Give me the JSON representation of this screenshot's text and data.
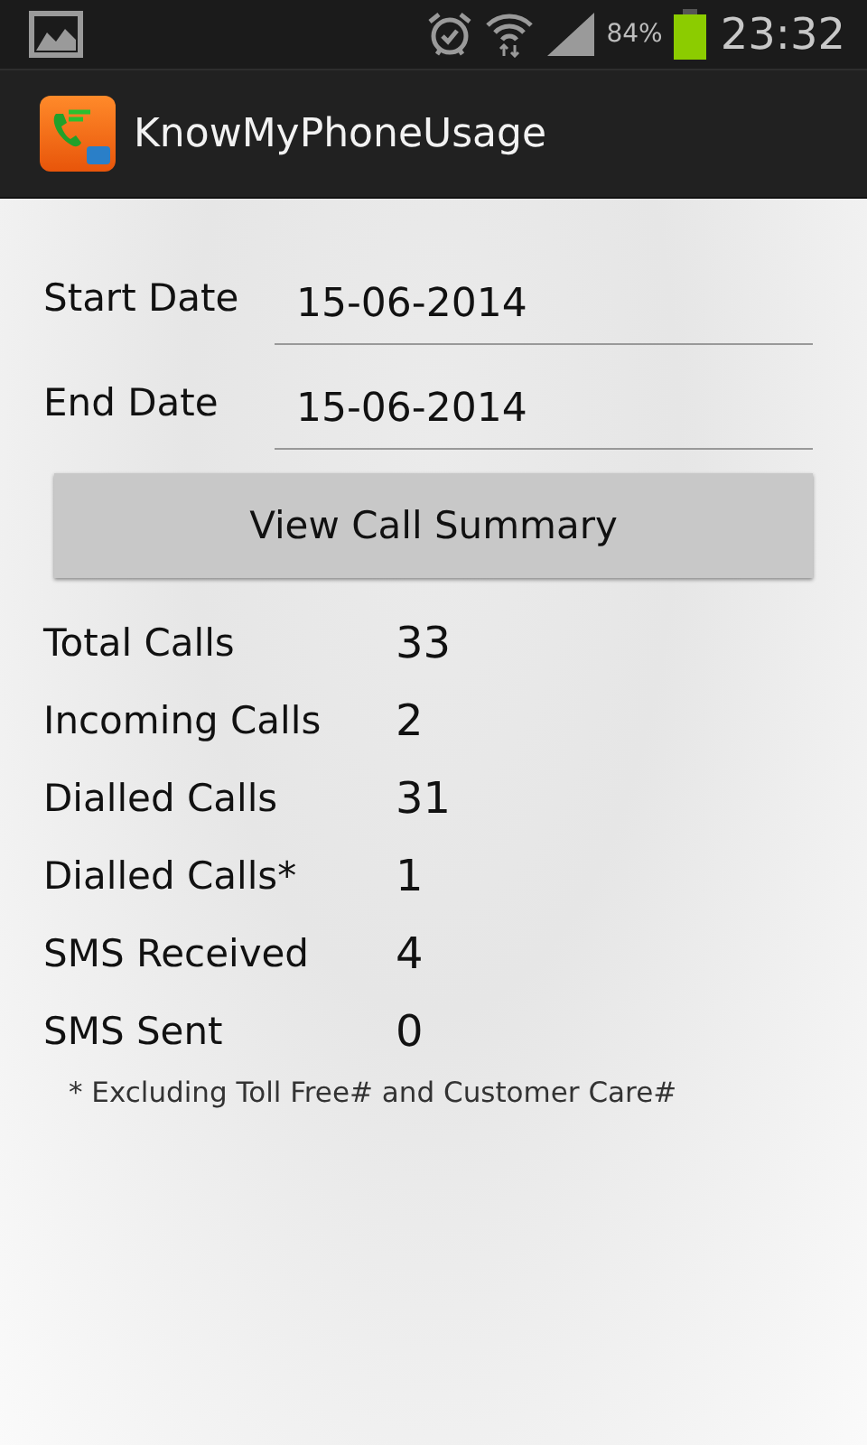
{
  "status_bar": {
    "battery_percent": "84%",
    "time": "23:32"
  },
  "action_bar": {
    "title": "KnowMyPhoneUsage"
  },
  "date_fields": [
    {
      "label": "Start Date",
      "value": "15-06-2014"
    },
    {
      "label": "End Date",
      "value": "15-06-2014"
    }
  ],
  "summary_button": {
    "label": "View Call Summary"
  },
  "stats": [
    {
      "label": "Total Calls",
      "value": "33"
    },
    {
      "label": "Incoming Calls",
      "value": "2"
    },
    {
      "label": "Dialled Calls",
      "value": "31"
    },
    {
      "label": "Dialled Calls*",
      "value": "1"
    },
    {
      "label": "SMS Received",
      "value": "4"
    },
    {
      "label": "SMS Sent",
      "value": "0"
    }
  ],
  "footnote": "* Excluding Toll Free# and Customer Care#"
}
